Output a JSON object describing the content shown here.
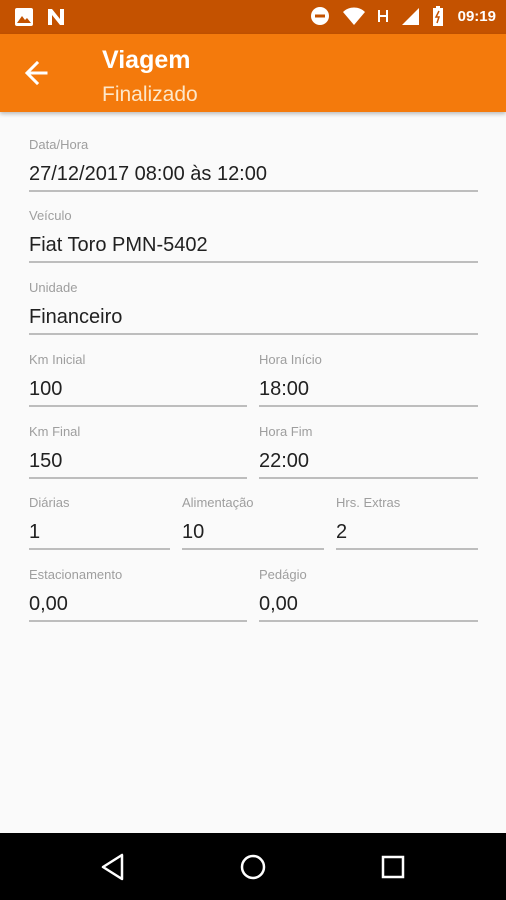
{
  "status_bar": {
    "time": "09:19",
    "left_icons": [
      "image-icon",
      "n-notification-icon"
    ],
    "right_icons": [
      "do-not-disturb-icon",
      "wifi-icon",
      "h-network-icon",
      "signal-icon",
      "battery-icon"
    ]
  },
  "app_bar": {
    "title": "Viagem",
    "subtitle": "Finalizado",
    "color": "#f47a0c"
  },
  "form": {
    "data_hora": {
      "label": "Data/Hora",
      "value": "27/12/2017 08:00 às 12:00"
    },
    "veiculo": {
      "label": "Veículo",
      "value": "Fiat Toro PMN-5402"
    },
    "unidade": {
      "label": "Unidade",
      "value": "Financeiro"
    },
    "km_inicial": {
      "label": "Km Inicial",
      "value": "100"
    },
    "hora_inicio": {
      "label": "Hora Início",
      "value": "18:00"
    },
    "km_final": {
      "label": "Km Final",
      "value": "150"
    },
    "hora_fim": {
      "label": "Hora Fim",
      "value": "22:00"
    },
    "diarias": {
      "label": "Diárias",
      "value": "1"
    },
    "alimentacao": {
      "label": "Alimentação",
      "value": "10"
    },
    "hrs_extras": {
      "label": "Hrs. Extras",
      "value": "2"
    },
    "estacionamento": {
      "label": "Estacionamento",
      "value": "0,00"
    },
    "pedagio": {
      "label": "Pedágio",
      "value": "0,00"
    }
  },
  "nav_bar": {
    "buttons": [
      "back-triangle-icon",
      "home-circle-icon",
      "recents-square-icon"
    ]
  }
}
